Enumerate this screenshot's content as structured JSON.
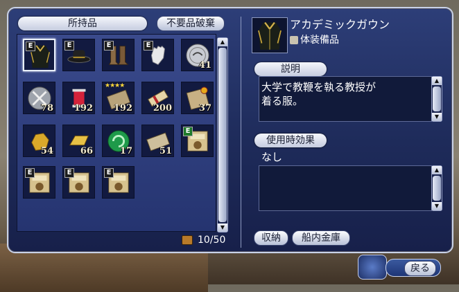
{
  "inventory": {
    "title": "所持品",
    "discard_button": "不要品破棄",
    "capacity": "10/50",
    "slots": [
      {
        "icon": "academic-gown-icon",
        "badge": "E",
        "qty": "",
        "selected": true
      },
      {
        "icon": "black-hat-icon",
        "badge": "E",
        "qty": ""
      },
      {
        "icon": "leather-boots-icon",
        "badge": "E",
        "qty": ""
      },
      {
        "icon": "white-gloves-icon",
        "badge": "E",
        "qty": ""
      },
      {
        "icon": "silver-coin-icon",
        "badge": "",
        "qty": "41"
      },
      {
        "icon": "swords-medal-icon",
        "badge": "",
        "qty": "78"
      },
      {
        "icon": "red-thread-spool-icon",
        "badge": "",
        "qty": "192"
      },
      {
        "icon": "parchment-deed-icon",
        "badge": "",
        "qty": "192",
        "stars": "★★★★"
      },
      {
        "icon": "rolled-scroll-icon",
        "badge": "",
        "qty": "200"
      },
      {
        "icon": "sealed-document-icon",
        "badge": "",
        "qty": "37"
      },
      {
        "icon": "gold-nugget-icon",
        "badge": "",
        "qty": "54"
      },
      {
        "icon": "gold-bar-icon",
        "badge": "",
        "qty": "66"
      },
      {
        "icon": "green-jade-swirl-icon",
        "badge": "",
        "qty": "17"
      },
      {
        "icon": "trade-ticket-icon",
        "badge": "",
        "qty": "51"
      },
      {
        "icon": "recipe-book-icon",
        "badge": "E",
        "badge_color": "green",
        "qty": ""
      },
      {
        "icon": "recipe-book-icon",
        "badge": "E",
        "qty": ""
      },
      {
        "icon": "recipe-book-icon",
        "badge": "E",
        "qty": ""
      },
      {
        "icon": "recipe-book-icon",
        "badge": "E",
        "qty": ""
      }
    ]
  },
  "detail": {
    "item_name": "アカデミックガウン",
    "item_category": "体装備品",
    "description_label": "説明",
    "description_lines": [
      "大学で教鞭を執る教授が",
      "着る服。"
    ],
    "effect_label": "使用時効果",
    "effect_text": "なし",
    "store_button": "収納",
    "ship_vault_button": "船内金庫"
  },
  "footer": {
    "back_button": "戻る"
  }
}
